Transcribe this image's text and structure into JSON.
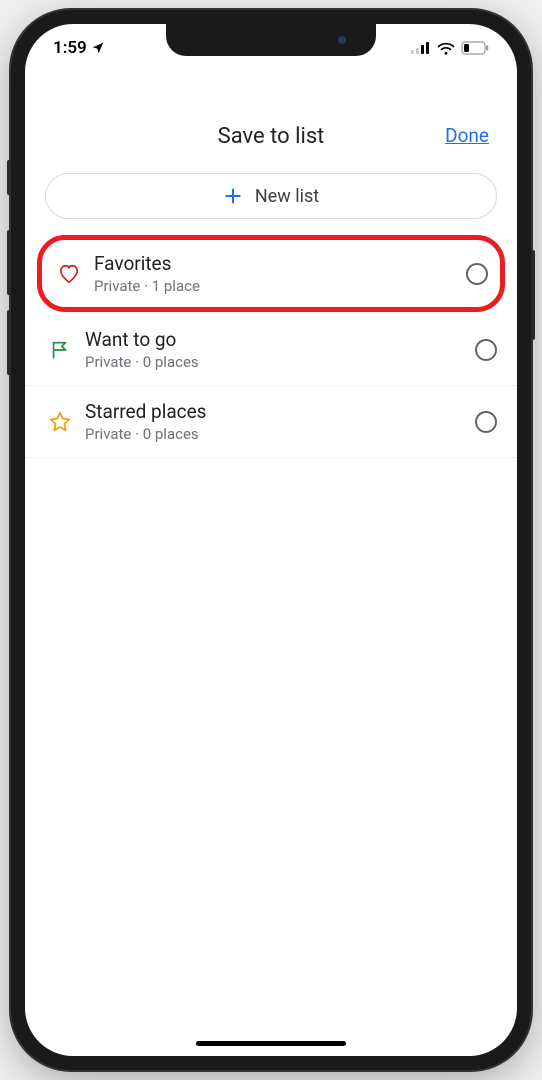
{
  "statusbar": {
    "time": "1:59"
  },
  "header": {
    "title": "Save to list",
    "done": "Done"
  },
  "new_list": {
    "label": "New list"
  },
  "lists": [
    {
      "icon": "heart",
      "title": "Favorites",
      "subtitle": "Private · 1 place",
      "highlighted": true
    },
    {
      "icon": "flag",
      "title": "Want to go",
      "subtitle": "Private · 0 places",
      "highlighted": false
    },
    {
      "icon": "star",
      "title": "Starred places",
      "subtitle": "Private · 0 places",
      "highlighted": false
    }
  ]
}
